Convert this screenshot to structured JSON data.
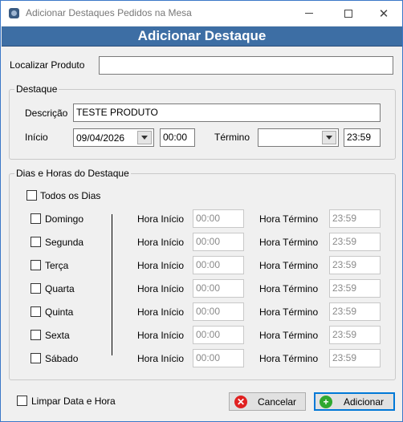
{
  "window": {
    "title": "Adicionar Destaques Pedidos na Mesa",
    "header": "Adicionar Destaque"
  },
  "search": {
    "label": "Localizar Produto",
    "value": ""
  },
  "destaque": {
    "group_title": "Destaque",
    "descricao_label": "Descrição",
    "descricao_value": "TESTE PRODUTO",
    "inicio_label": "Início",
    "inicio_date": "09/04/2026",
    "inicio_time": "00:00",
    "termino_label": "Término",
    "termino_date": "",
    "termino_time": "23:59"
  },
  "dias": {
    "group_title": "Dias e Horas do Destaque",
    "todos_label": "Todos os Dias",
    "hora_inicio_label": "Hora Início",
    "hora_termino_label": "Hora Término",
    "days": [
      {
        "name": "Domingo",
        "start": "00:00",
        "end": "23:59"
      },
      {
        "name": "Segunda",
        "start": "00:00",
        "end": "23:59"
      },
      {
        "name": "Terça",
        "start": "00:00",
        "end": "23:59"
      },
      {
        "name": "Quarta",
        "start": "00:00",
        "end": "23:59"
      },
      {
        "name": "Quinta",
        "start": "00:00",
        "end": "23:59"
      },
      {
        "name": "Sexta",
        "start": "00:00",
        "end": "23:59"
      },
      {
        "name": "Sábado",
        "start": "00:00",
        "end": "23:59"
      }
    ]
  },
  "footer": {
    "limpar_label": "Limpar Data e Hora",
    "cancel_label": "Cancelar",
    "add_label": "Adicionar"
  },
  "colors": {
    "header_bg": "#3d6ea4",
    "cancel_icon": "#e02020",
    "add_icon": "#2fa82f"
  },
  "icons": {
    "app": "app-icon",
    "cancel": "x-circle-icon",
    "add": "plus-circle-icon"
  }
}
